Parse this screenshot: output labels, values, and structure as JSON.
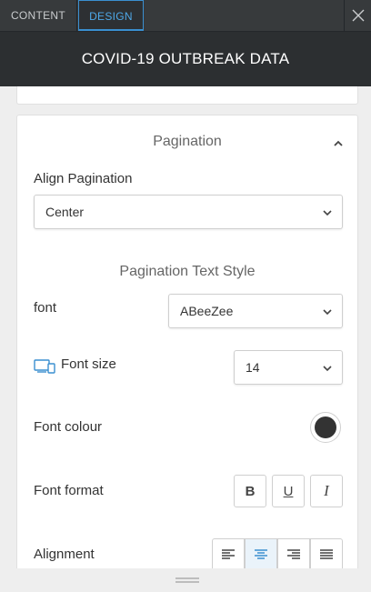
{
  "tabs": [
    {
      "label": "CONTENT",
      "active": false
    },
    {
      "label": "DESIGN",
      "active": true
    }
  ],
  "header": {
    "title": "COVID-19 OUTBREAK DATA"
  },
  "pagination": {
    "section_title": "Pagination",
    "align_label": "Align Pagination",
    "align_value": "Center",
    "text_style_title": "Pagination Text Style",
    "font_label": "font",
    "font_value": "ABeeZee",
    "font_size_label": "Font size",
    "font_size_value": "14",
    "font_colour_label": "Font colour",
    "font_colour": "#333333",
    "font_format_label": "Font format",
    "format_buttons": [
      "B",
      "U",
      "I"
    ],
    "alignment_label": "Alignment",
    "alignment_options": [
      "left",
      "center",
      "right",
      "justify"
    ],
    "alignment_active": "center"
  },
  "colors": {
    "topbar": "#373a3c",
    "titlebar": "#2c2f31",
    "accent": "#3a8fd0"
  }
}
